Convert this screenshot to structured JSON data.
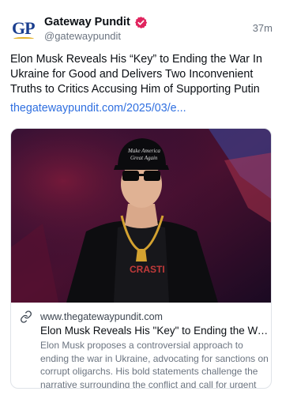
{
  "author": {
    "avatar_text": "GP",
    "display_name": "Gateway Pundit",
    "handle": "@gatewaypundit",
    "verified_icon": "verified-badge-icon",
    "verified_color": "#e0245e"
  },
  "post": {
    "time": "37m",
    "text": "Elon Musk Reveals His “Key” to Ending the War In Ukraine for Good and Delivers Two Inconvenient Truths to Critics Accusing Him of Supporting Putin",
    "link_text": "thegatewaypundit.com/2025/03/e..."
  },
  "card": {
    "link_icon": "link-icon",
    "domain": "www.thegatewaypundit.com",
    "title": "Elon Musk Reveals His \"Key\" to Ending the War...",
    "description": "Elon Musk proposes a controversial approach to ending the war in Ukraine, advocating for sanctions on corrupt oligarchs. His bold statements challenge the narrative surrounding the conflict and call for urgent action."
  },
  "colors": {
    "link": "#2f6fe0",
    "muted": "#6b7480",
    "border": "#dfe3e8"
  }
}
